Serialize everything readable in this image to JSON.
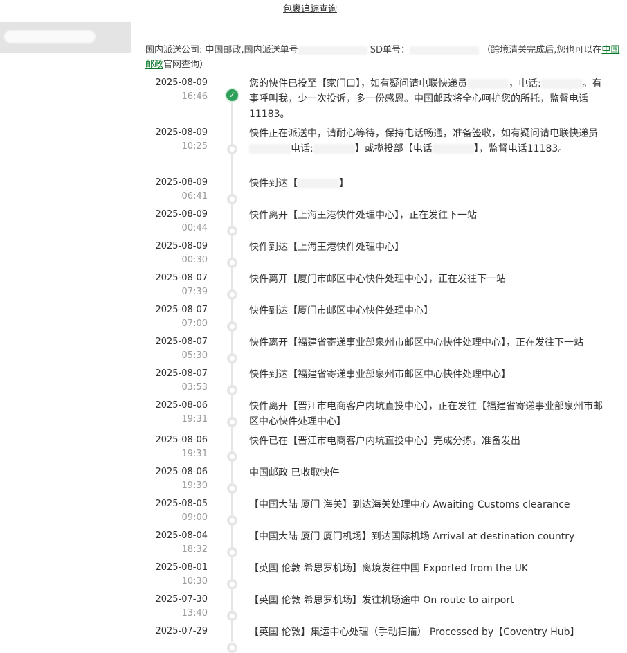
{
  "header": {
    "link_label": "包裹追踪查询"
  },
  "info": {
    "prefix": "国内派送公司: 中国邮政,国内派送单号",
    "sd_label": "SD单号：",
    "note_before": "（跨境清关完成后,您也可以在",
    "link": "中国邮政",
    "note_after": "官网查询）"
  },
  "events": [
    {
      "date": "2025-08-09",
      "time": "16:46",
      "current": true,
      "parts": [
        "您的快件已投至【家门口】，如有疑问请电联快递员",
        "，电话:",
        "。有事呼叫我，少一次投诉，多一份感恩。中国邮政将全心呵护您的所托，监督电话11183。"
      ]
    },
    {
      "date": "2025-08-09",
      "time": "10:25",
      "parts": [
        "快件正在派送中，请耐心等待，保持电话畅通，准备签收，如有疑问请电联快递员",
        "电话:",
        "】或揽投部【电话",
        "】，监督电话11183。"
      ]
    },
    {
      "date": "2025-08-09",
      "time": "06:41",
      "parts": [
        "快件到达【",
        "】"
      ]
    },
    {
      "date": "2025-08-09",
      "time": "00:44",
      "parts": [
        "快件离开【上海王港快件处理中心】，正在发往下一站"
      ]
    },
    {
      "date": "2025-08-09",
      "time": "00:30",
      "parts": [
        "快件到达【上海王港快件处理中心】"
      ]
    },
    {
      "date": "2025-08-07",
      "time": "07:39",
      "parts": [
        "快件离开【厦门市邮区中心快件处理中心】，正在发往下一站"
      ]
    },
    {
      "date": "2025-08-07",
      "time": "07:00",
      "parts": [
        "快件到达【厦门市邮区中心快件处理中心】"
      ]
    },
    {
      "date": "2025-08-07",
      "time": "05:30",
      "parts": [
        "快件离开【福建省寄递事业部泉州市邮区中心快件处理中心】，正在发往下一站"
      ]
    },
    {
      "date": "2025-08-07",
      "time": "03:53",
      "parts": [
        "快件到达【福建省寄递事业部泉州市邮区中心快件处理中心】"
      ]
    },
    {
      "date": "2025-08-06",
      "time": "19:31",
      "parts": [
        "快件离开【晋江市电商客户内坑直投中心】，正在发往【福建省寄递事业部泉州市邮区中心快件处理中心】"
      ]
    },
    {
      "date": "2025-08-06",
      "time": "19:31",
      "parts": [
        "快件已在【晋江市电商客户内坑直投中心】完成分拣，准备发出"
      ]
    },
    {
      "date": "2025-08-06",
      "time": "19:30",
      "parts": [
        "中国邮政 已收取快件"
      ]
    },
    {
      "date": "2025-08-05",
      "time": "09:00",
      "parts": [
        "【中国大陆 厦门 海关】到达海关处理中心 Awaiting Customs clearance"
      ]
    },
    {
      "date": "2025-08-04",
      "time": "18:32",
      "parts": [
        "【中国大陆 厦门 厦门机场】到达国际机场 Arrival at destination country"
      ]
    },
    {
      "date": "2025-08-01",
      "time": "10:30",
      "parts": [
        "【英国 伦敦 希思罗机场】离境发往中国 Exported from the UK"
      ]
    },
    {
      "date": "2025-07-30",
      "time": "13:40",
      "parts": [
        "【英国 伦敦 希思罗机场】发往机场途中 On route to airport"
      ]
    },
    {
      "date": "2025-07-29",
      "time": "",
      "parts": [
        "【英国 伦敦】集运中心处理（手动扫描） Processed by【Coventry Hub】"
      ]
    }
  ]
}
